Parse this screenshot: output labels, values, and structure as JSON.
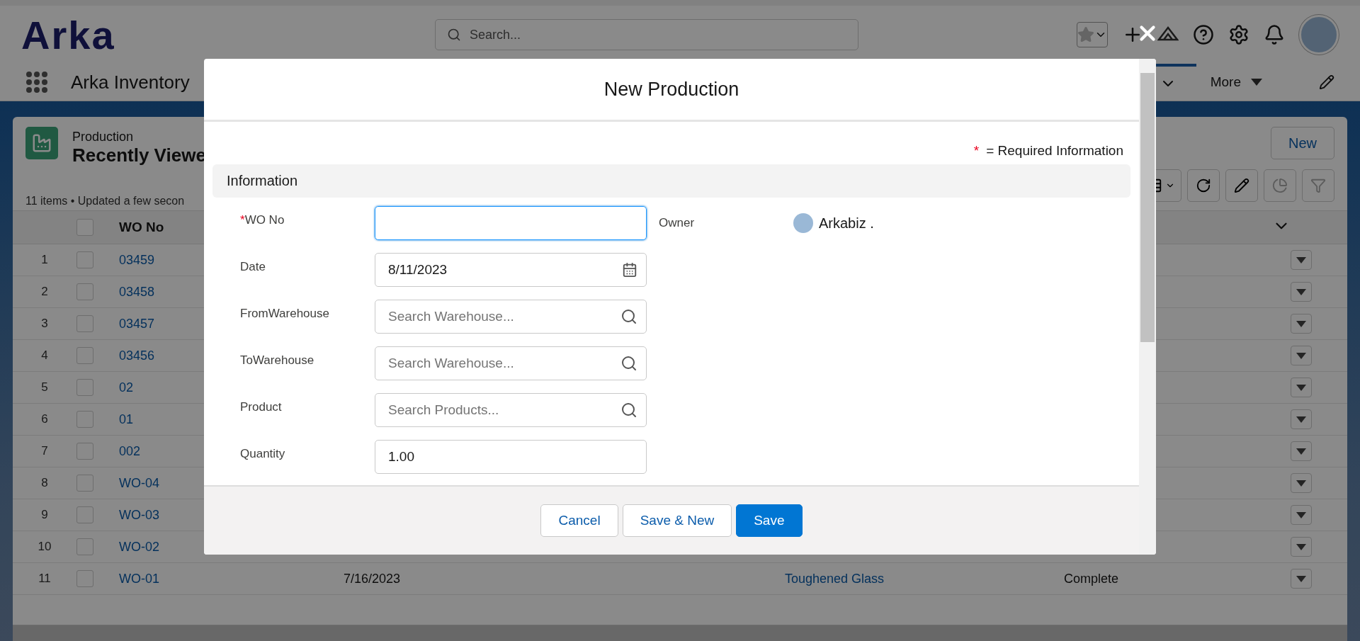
{
  "header": {
    "logo": "Arka",
    "search": {
      "placeholder": "Search..."
    }
  },
  "nav": {
    "app_name": "Arka Inventory",
    "more": "More"
  },
  "list": {
    "object": "Production",
    "view": "Recently Viewe",
    "summary": "11 items • Updated a few secon",
    "new_button": "New",
    "columns": [
      {
        "label": "WO No"
      }
    ],
    "select_all": {
      "checked": false
    },
    "rows": [
      {
        "num": "1",
        "wo_no": "03459",
        "checked": false
      },
      {
        "num": "2",
        "wo_no": "03458",
        "checked": false
      },
      {
        "num": "3",
        "wo_no": "03457",
        "checked": false
      },
      {
        "num": "4",
        "wo_no": "03456",
        "checked": false
      },
      {
        "num": "5",
        "wo_no": "02",
        "checked": false
      },
      {
        "num": "6",
        "wo_no": "01",
        "checked": false
      },
      {
        "num": "7",
        "wo_no": "002",
        "checked": false
      },
      {
        "num": "8",
        "wo_no": "WO-04",
        "checked": false
      },
      {
        "num": "9",
        "wo_no": "WO-03",
        "checked": false
      },
      {
        "num": "10",
        "wo_no": "WO-02",
        "checked": false
      },
      {
        "num": "11",
        "wo_no": "WO-01",
        "checked": false,
        "date": "7/16/2023",
        "product": "Toughened Glass",
        "status": "Complete"
      }
    ]
  },
  "modal": {
    "title": "New Production",
    "required_note": "= Required Information",
    "required_mark": "*",
    "section": "Information",
    "fields": [
      {
        "kind": "text",
        "label": "WO No",
        "required": true,
        "focused": true
      },
      {
        "kind": "date",
        "label": "Date",
        "required": false,
        "focused": false,
        "value": "8/11/2023"
      },
      {
        "kind": "lookup",
        "label": "FromWarehouse",
        "required": false,
        "focused": false,
        "placeholder": "Search Warehouse..."
      },
      {
        "kind": "lookup",
        "label": "ToWarehouse",
        "required": false,
        "focused": false,
        "placeholder": "Search Warehouse..."
      },
      {
        "kind": "lookup",
        "label": "Product",
        "required": false,
        "focused": false,
        "placeholder": "Search Products..."
      },
      {
        "kind": "text",
        "label": "Quantity",
        "required": false,
        "focused": false,
        "value": "1.00"
      }
    ],
    "owner": {
      "label": "Owner",
      "value": "Arkabiz ."
    },
    "buttons": [
      {
        "label": "Cancel",
        "kind": "neutral"
      },
      {
        "label": "Save & New",
        "kind": "neutral"
      },
      {
        "label": "Save",
        "kind": "brand"
      }
    ]
  }
}
